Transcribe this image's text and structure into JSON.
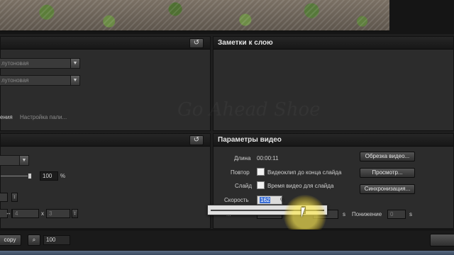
{
  "layer_panel": {
    "select1_value": "лутоновая",
    "select2_value": "лутоновая",
    "mode_label": "ения",
    "mode_hint": "Настройка пали..."
  },
  "notes_panel": {
    "title": "Заметки к слою"
  },
  "transform_panel": {
    "slider_value": "100",
    "percent": "%",
    "x_sep": "x",
    "width_value": "4",
    "height_value": "3"
  },
  "video_panel": {
    "title": "Параметры видео",
    "length_label": "Длина",
    "length_value": "00:00:11",
    "repeat_label": "Повтор",
    "repeat_checkbox_label": "Видеоклип до конца слайда",
    "slide_label": "Слайд",
    "slide_checkbox_label": "Время видео для слайда",
    "speed_label": "Скорость",
    "speed_value": "162",
    "speed_unit": "%",
    "trim_button": "Обрезка видео...",
    "preview_button": "Просмотр...",
    "sync_button": "Синхронизация...",
    "seconds_unit": "s",
    "lower_label": "Понижение",
    "lower_value": "0",
    "lower_unit": "s",
    "partial_label": "...",
    "speed_slider_level": 0.82
  },
  "bottom_bar": {
    "copy_button": "copy",
    "zoom_value": "100"
  },
  "watermark": "Go Ahead Shoe"
}
